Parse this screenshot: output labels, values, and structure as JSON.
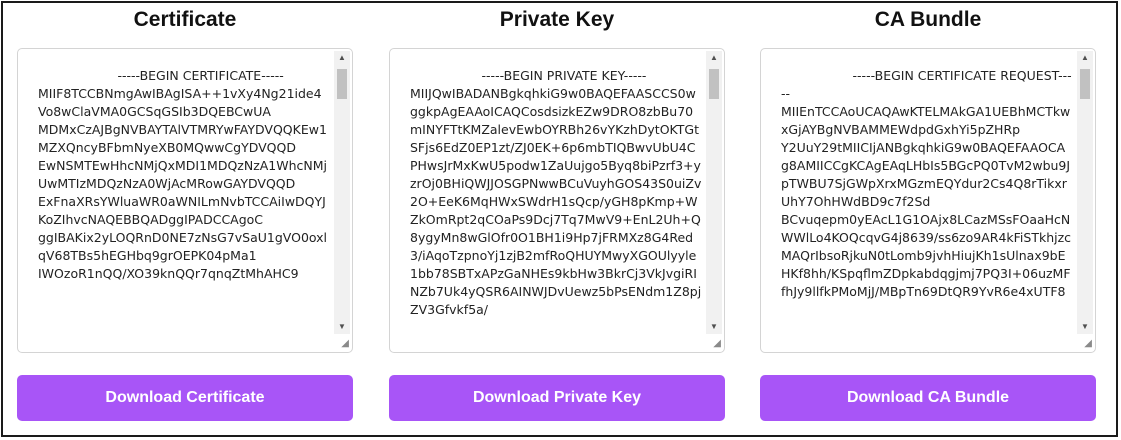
{
  "panels": [
    {
      "title": "Certificate",
      "content": "                    -----BEGIN CERTIFICATE-----\nMIIF8TCCBNmgAwIBAgISA++1vXy4Ng21ide4Vo8wClaVMA0GCSqGSIb3DQEBCwUA\nMDMxCzAJBgNVBAYTAlVTMRYwFAYDVQQKEw1MZXQncyBFbmNyeXB0MQwwCgYDVQQD\nEwNSMTEwHhcNMjQxMDI1MDQzNzA1WhcNMjUwMTIzMDQzNzA0WjAcMRowGAYDVQQD\nExFnaXRsYWluaWR0aWNILmNvbTCCAiIwDQYJKoZIhvcNAQEBBQADggIPADCCAgoC\nggIBAKix2yLOQRnD0NE7zNsG7vSaU1gVO0oxlqV68TBs5hEGHbq9grOEPK04pMa1\nIWOzoR1nQQ/XO39knQQr7qnqZtMhAHC9",
      "button": "Download Certificate"
    },
    {
      "title": "Private Key",
      "content": "                  -----BEGIN PRIVATE KEY-----\nMIIJQwIBADANBgkqhkiG9w0BAQEFAASCCS0wggkpAgEAAoICAQCosdsizkEZw9DRO8zbBu70mINYFTtKMZalevEwbOYRBh26vYKzhDytOKTGtSFjs6EdZ0EP1zt/ZJ0EK+6p6mbTIQBwvUbU4CPHwsJrMxKwU5podw1ZaUujgo5Byq8biPzrf3+yzrOj0BHiQWJJOSGPNwwBCuVuyhGOS43S0uiZv2O+EeK6MqHWxSWdrH1sQcp/yGH8pKmp+WZkOmRpt2qCOaPs9Dcj7Tq7MwV9+EnL2Uh+Q8ygyMn8wGlOfr0O1BH1i9Hp7jFRMXz8G4Red3/iAqoTzpnoYj1zjB2mfRoQHUYMwyXGOUlyyle1bb78SBTxAPzGaNHEs9kbHw3BkrCj3VkJvgiRINZb7Uk4yQSR6AINWJDvUewz5bPsENdm1Z8pjZV3Gfvkf5a/",
      "button": "Download Private Key"
    },
    {
      "title": "CA Bundle",
      "content": "                  -----BEGIN CERTIFICATE REQUEST-----\nMIIEnTCCAoUCAQAwKTELMAkGA1UEBhMCTkwxGjAYBgNVBAMMEWdpdGxhYi5pZHRp\nY2UuY29tMIICIjANBgkqhkiG9w0BAQEFAAOCAg8AMIICCgKCAgEAqLHbIs5BGcPQ0TvM2wbu9JpTWBU7SjGWpXrxMGzmEQYdur2Cs4Q8rTikxrUhY7OhHWdBD9c7f2Sd\nBCvuqepm0yEAcL1G1OAjx8LCazMSsFOaaHcNWWlLo4KOQcqvG4j8639/ss6zo9AR4kFiSTkhjzcMAQrIbsoRjkuN0tLomb9jvhHiujKh1sUlnax9bEHKf8hh/KSpqflmZDpkabdqgjmj7PQ3I+06uzMFfhJy9llfkPMoMjJ/MBpTn69DtQR9YvR6e4xUTF8",
      "button": "Download CA Bundle"
    }
  ],
  "icons": {
    "scroll_up": "▲",
    "scroll_down": "▼",
    "resize_grip": "◢"
  }
}
